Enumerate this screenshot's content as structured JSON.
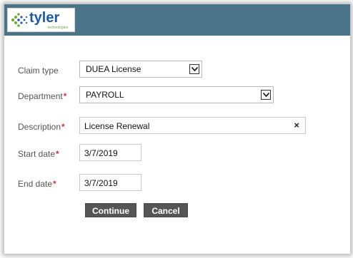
{
  "brand": {
    "name": "tyler",
    "tagline": "technologies",
    "icon": "tyler-logo-icon",
    "header_color": "#4b7488",
    "wordmark_color": "#1d5aa8",
    "accent_green": "#6cae3e"
  },
  "form": {
    "claim_type": {
      "label": "Claim type",
      "value": "DUEA License"
    },
    "department": {
      "label": "Department",
      "required_mark": "*",
      "value": "PAYROLL"
    },
    "description": {
      "label": "Description",
      "required_mark": "*",
      "value": "License Renewal",
      "clear_icon": "×"
    },
    "start_date": {
      "label": "Start date",
      "required_mark": "*",
      "value": "3/7/2019"
    },
    "end_date": {
      "label": "End date",
      "required_mark": "*",
      "value": "3/7/2019"
    }
  },
  "actions": {
    "continue_label": "Continue",
    "cancel_label": "Cancel"
  },
  "colors": {
    "required": "#d3342f",
    "button_bg": "#555555"
  }
}
